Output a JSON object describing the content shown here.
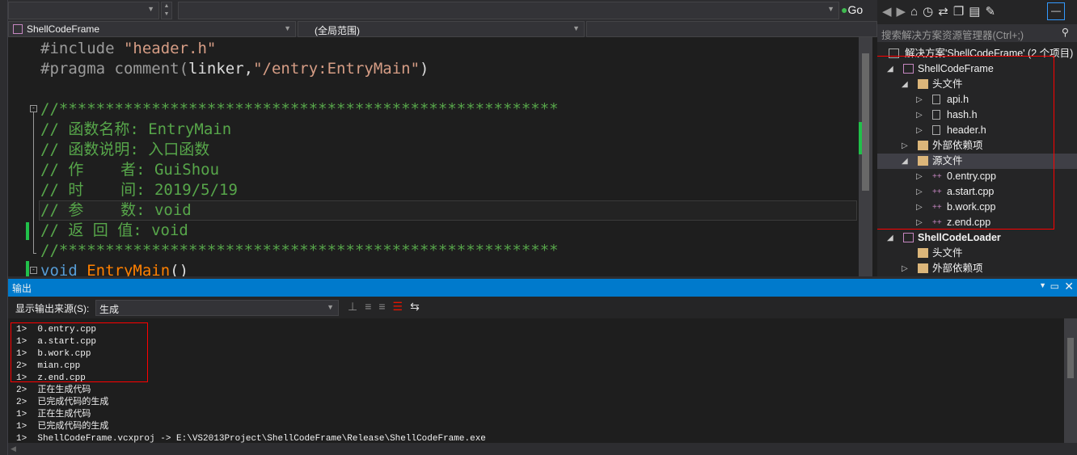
{
  "toolbar": {
    "go_label": "Go"
  },
  "nav": {
    "project": "ShellCodeFrame",
    "scope": "(全局范围)"
  },
  "code": {
    "l1a": "#include ",
    "l1b": "\"header.h\"",
    "l2a": "#pragma comment(",
    "l2b": "linker,",
    "l2c": "\"/entry:EntryMain\"",
    "l2d": ")",
    "stars": "//******************************************************",
    "c1": "// 函数名称: EntryMain",
    "c2": "// 函数说明: 入口函数",
    "c3": "// 作    者: GuiShou",
    "c4": "// 时    间: 2019/5/19",
    "c5": "// 参    数: void",
    "c6": "// 返 回 值: void",
    "void_kw": "void ",
    "func_name": "EntryMain",
    "parens": "()"
  },
  "solution": {
    "search_placeholder": "搜索解决方案资源管理器(Ctrl+;)",
    "root": "解决方案'ShellCodeFrame' (2 个项目)",
    "items": [
      {
        "label": "ShellCodeFrame",
        "kind": "project"
      },
      {
        "label": "头文件",
        "kind": "folder"
      },
      {
        "label": "api.h",
        "kind": "header"
      },
      {
        "label": "hash.h",
        "kind": "header"
      },
      {
        "label": "header.h",
        "kind": "header"
      },
      {
        "label": "外部依赖项",
        "kind": "ext"
      },
      {
        "label": "源文件",
        "kind": "folder"
      },
      {
        "label": "0.entry.cpp",
        "kind": "cpp"
      },
      {
        "label": "a.start.cpp",
        "kind": "cpp"
      },
      {
        "label": "b.work.cpp",
        "kind": "cpp"
      },
      {
        "label": "z.end.cpp",
        "kind": "cpp"
      },
      {
        "label": "ShellCodeLoader",
        "kind": "project"
      },
      {
        "label": "头文件",
        "kind": "folder"
      },
      {
        "label": "外部依赖项",
        "kind": "ext"
      }
    ]
  },
  "output": {
    "title": "输出",
    "source_label": "显示输出来源(S):",
    "source_value": "生成",
    "lines": [
      "1>  0.entry.cpp",
      "1>  a.start.cpp",
      "1>  b.work.cpp",
      "2>  mian.cpp",
      "1>  z.end.cpp",
      "2>  正在生成代码",
      "2>  已完成代码的生成",
      "1>  正在生成代码",
      "1>  已完成代码的生成",
      "1>  ShellCodeFrame.vcxproj -> E:\\VS2013Project\\ShellCodeFrame\\Release\\ShellCodeFrame.exe"
    ]
  },
  "colors": {
    "accent": "#007acc",
    "highlight_box": "#ff0000",
    "comment": "#57a64a"
  }
}
